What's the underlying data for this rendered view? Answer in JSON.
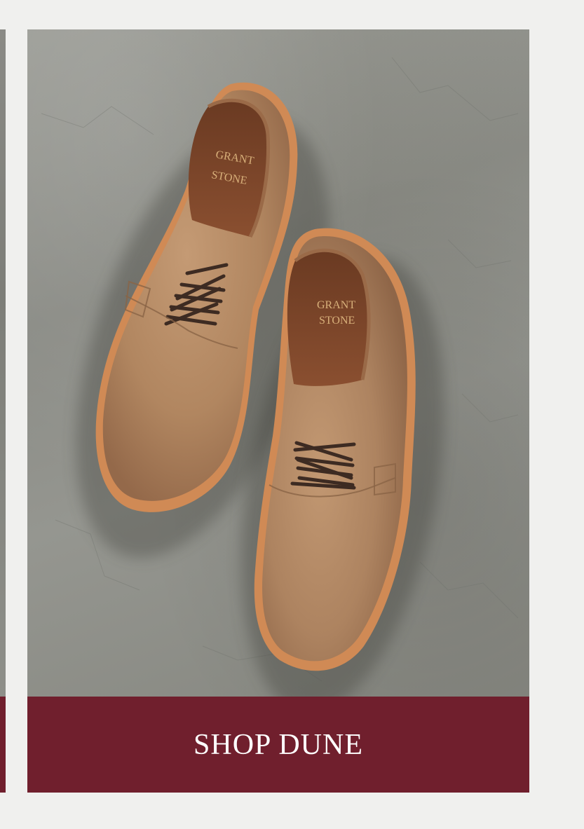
{
  "product_card": {
    "photo": {
      "insole_brand_line1": "GRANT",
      "insole_brand_line2": "STONE"
    },
    "cta_label": "SHOP DUNE"
  },
  "colors": {
    "page_background": "#f0f0ee",
    "cta_background": "#701f2d",
    "cta_text": "#ffffff",
    "leather": "#b88a63",
    "welt": "#d08a55",
    "concrete": "#8f908a"
  }
}
